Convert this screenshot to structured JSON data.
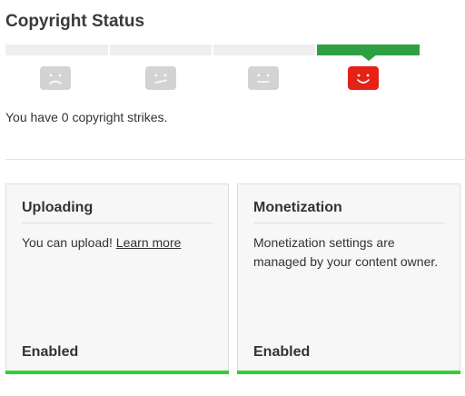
{
  "page": {
    "title": "Copyright Status"
  },
  "status_meter": {
    "segments": 4,
    "active_index": 3,
    "active_color": "#2ea043",
    "inactive_color": "#eeeeee",
    "faces": [
      {
        "icon": "sad-face-icon",
        "color": "#d3d3d3"
      },
      {
        "icon": "unsure-face-icon",
        "color": "#d3d3d3"
      },
      {
        "icon": "neutral-face-icon",
        "color": "#d3d3d3"
      },
      {
        "icon": "happy-face-icon",
        "color": "#e62117"
      }
    ]
  },
  "strikes": {
    "text": "You have 0 copyright strikes."
  },
  "cards": {
    "uploading": {
      "title": "Uploading",
      "body_text": "You can upload! ",
      "link_text": "Learn more",
      "status": "Enabled",
      "bar_color": "#2fd02f"
    },
    "monetization": {
      "title": "Monetization",
      "body_text": "Monetization settings are managed by your content owner.",
      "status": "Enabled",
      "bar_color": "#2fd02f"
    }
  }
}
